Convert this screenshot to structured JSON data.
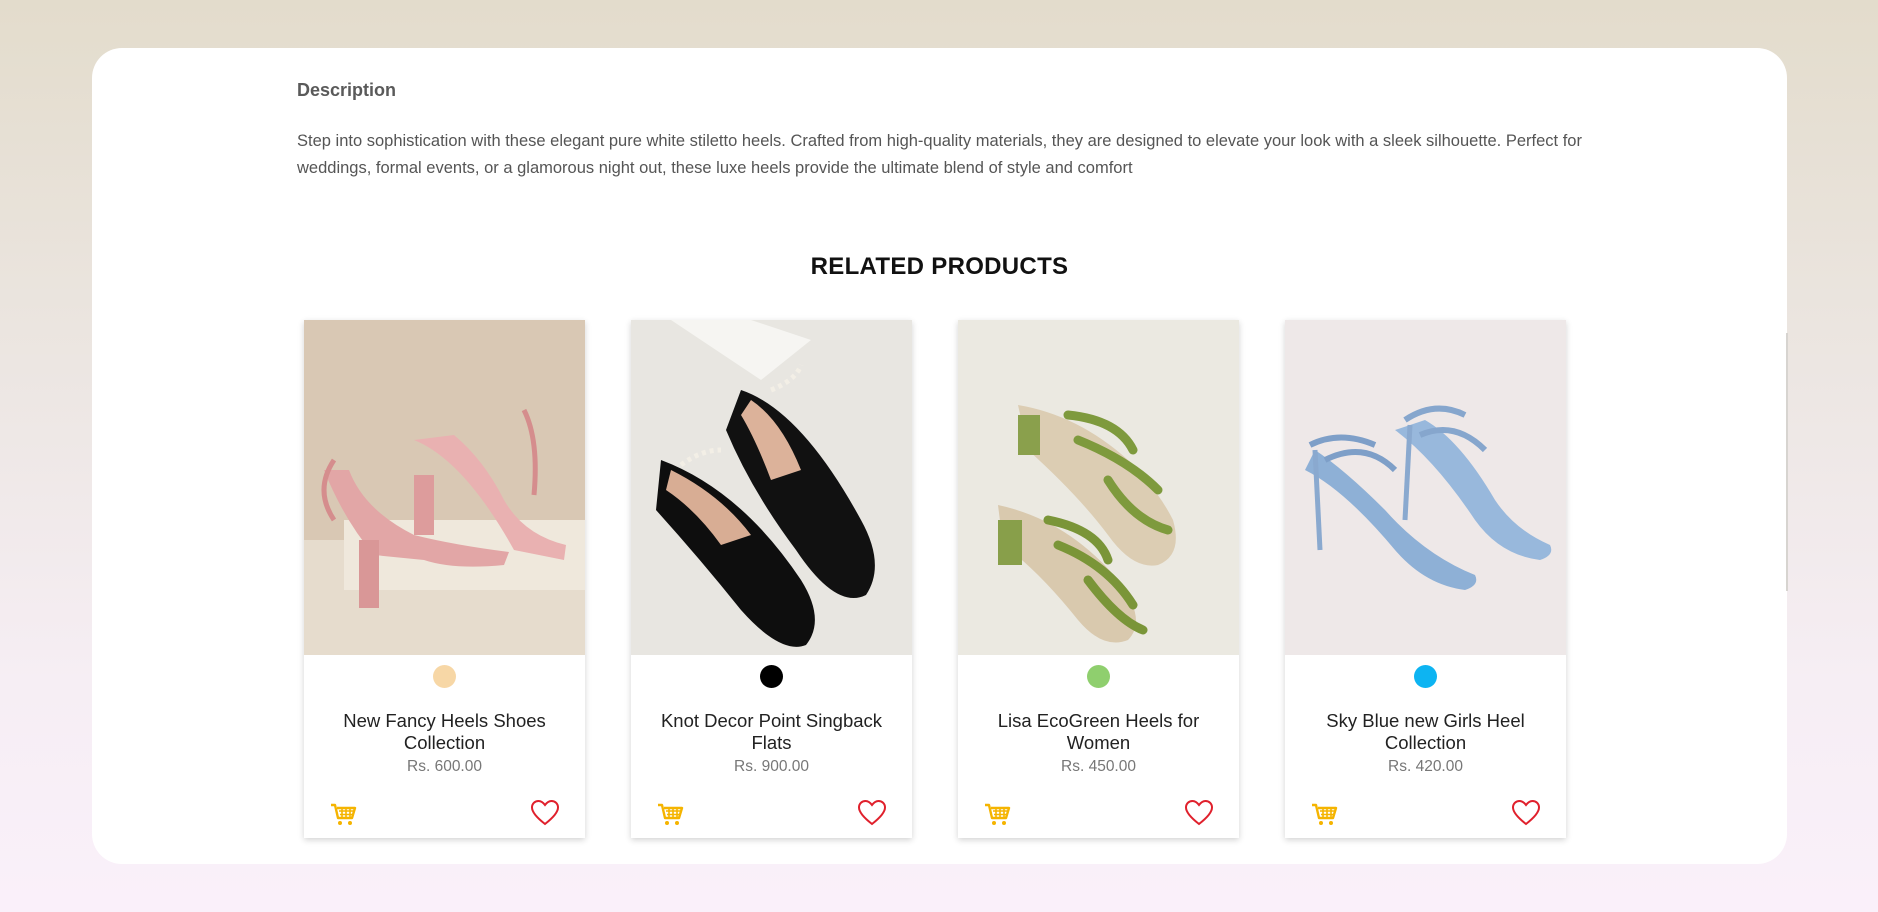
{
  "description": {
    "title": "Description",
    "text": "Step into sophistication with these elegant pure white stiletto heels. Crafted from high-quality materials, they are designed to elevate your look with a sleek silhouette. Perfect for weddings, formal events, or a glamorous night out, these luxe heels provide the ultimate blend of style and comfort"
  },
  "related": {
    "title": "RELATED PRODUCTS",
    "products": [
      {
        "name": "New Fancy Heels Shoes Collection",
        "price": "Rs. 600.00",
        "swatch_color": "#f7d7a6",
        "image": "pink-block-heel-sandals"
      },
      {
        "name": "Knot Decor Point Singback Flats",
        "price": "Rs. 900.00",
        "swatch_color": "#000000",
        "image": "black-pointed-flats"
      },
      {
        "name": "Lisa EcoGreen Heels for Women",
        "price": "Rs. 450.00",
        "swatch_color": "#8fcf6e",
        "image": "green-strappy-mules"
      },
      {
        "name": "Sky Blue new Girls Heel Collection",
        "price": "Rs. 420.00",
        "swatch_color": "#0db4f2",
        "image": "sky-blue-stiletto-sandals"
      }
    ]
  },
  "colors": {
    "cart": "#f5b400",
    "heart": "#e0202c"
  }
}
